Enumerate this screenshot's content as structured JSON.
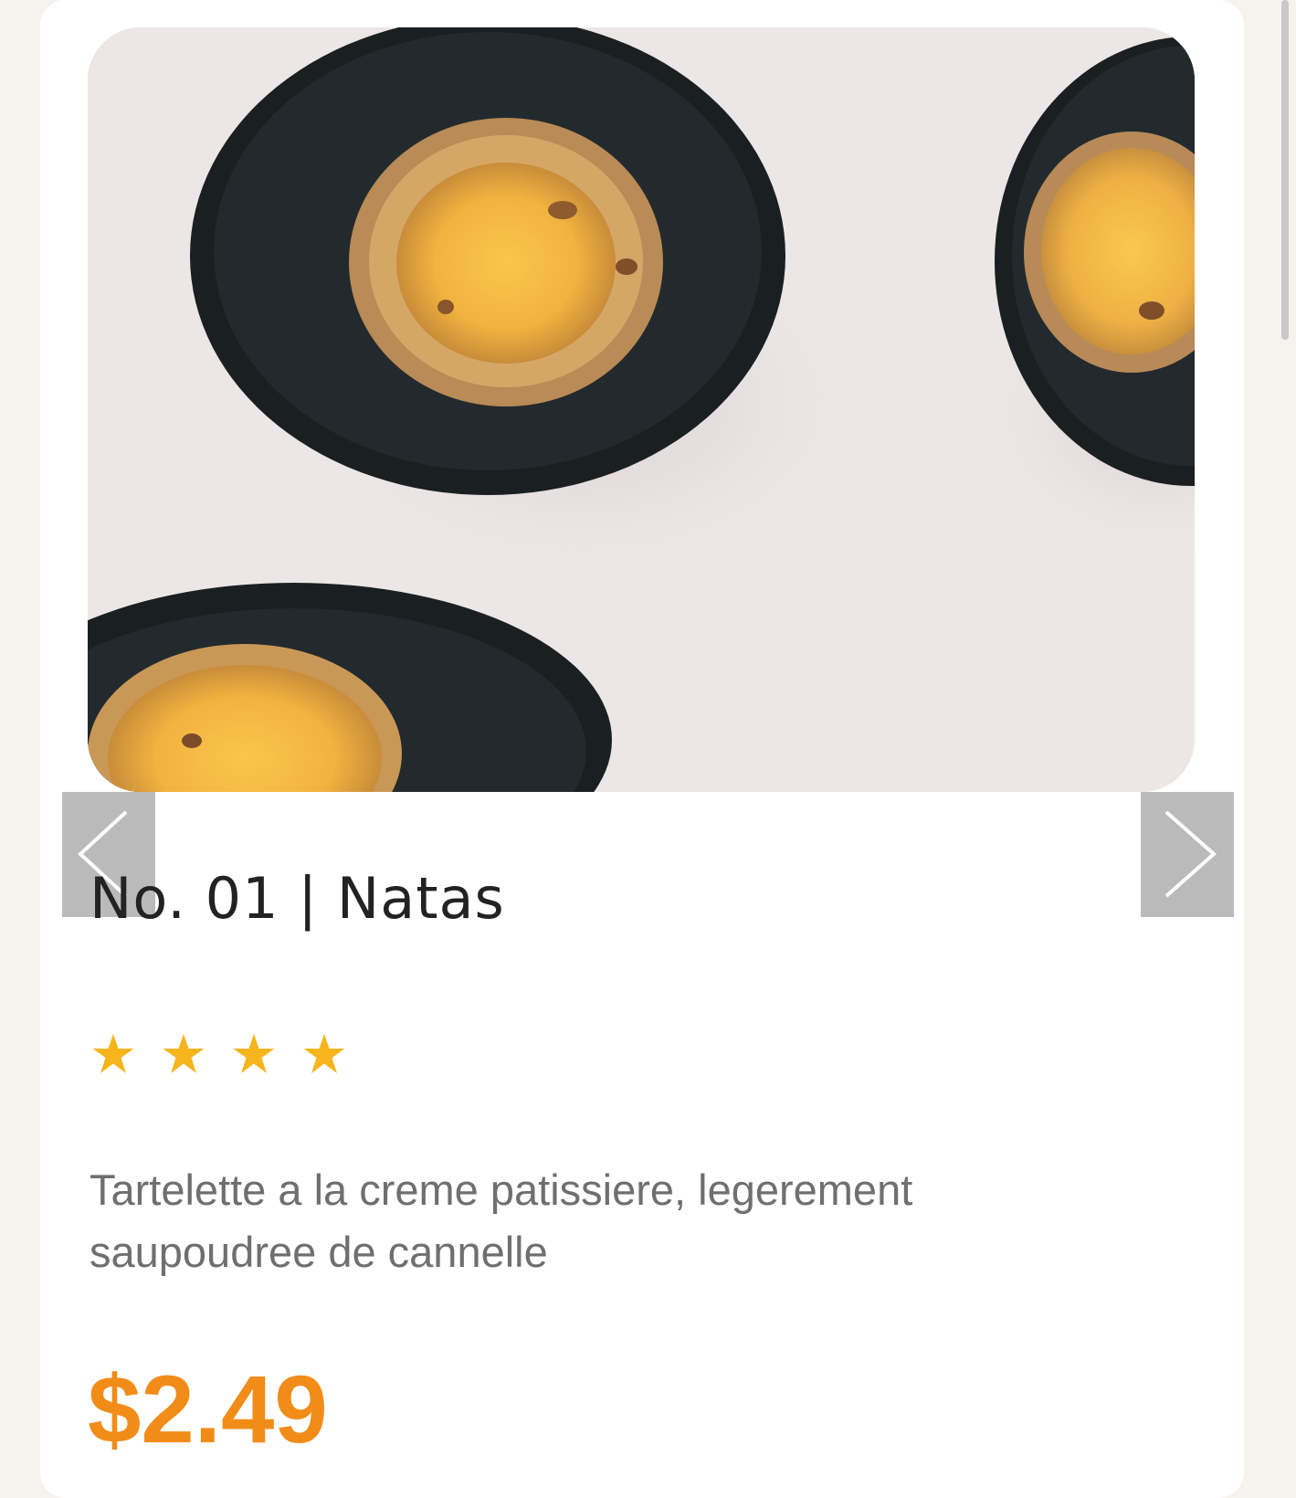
{
  "product": {
    "title": "No. 01 | Natas",
    "rating": 4,
    "description": "Tartelette a la creme patissiere, legerement saupoudree de cannelle",
    "price": "$2.49"
  },
  "controls": {
    "prev_icon": "chevron-left-icon",
    "next_icon": "chevron-right-icon"
  },
  "colors": {
    "price": "#f28c19",
    "star": "#f6b51d",
    "background": "#f6f2ee"
  }
}
